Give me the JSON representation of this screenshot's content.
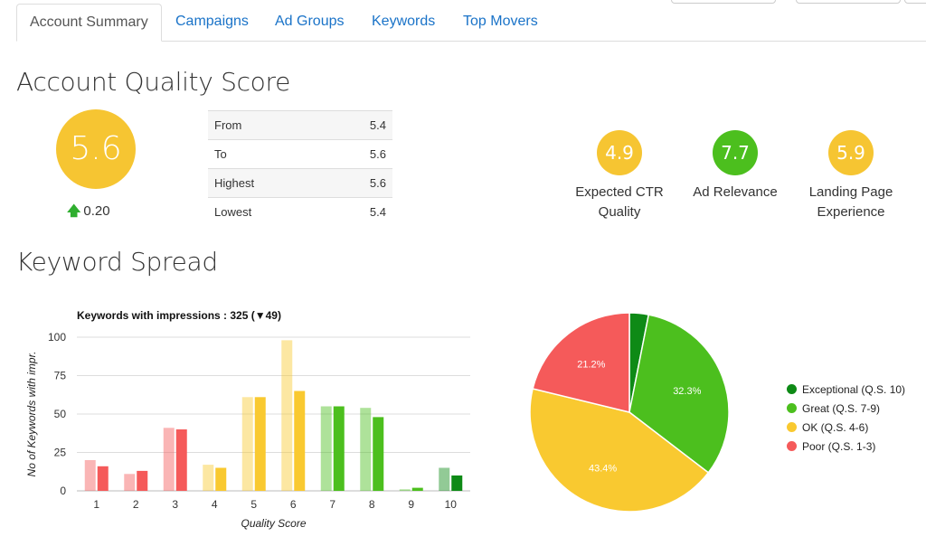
{
  "tabs": [
    {
      "label": "Account Summary",
      "active": true
    },
    {
      "label": "Campaigns",
      "active": false
    },
    {
      "label": "Ad Groups",
      "active": false
    },
    {
      "label": "Keywords",
      "active": false
    },
    {
      "label": "Top Movers",
      "active": false
    }
  ],
  "quality": {
    "heading": "Account Quality Score",
    "score": "5.6",
    "delta": "0.20",
    "table": [
      {
        "label": "From",
        "value": "5.4"
      },
      {
        "label": "To",
        "value": "5.6"
      },
      {
        "label": "Highest",
        "value": "5.6"
      },
      {
        "label": "Lowest",
        "value": "5.4"
      }
    ],
    "components": [
      {
        "value": "4.9",
        "line1": "Expected CTR",
        "line2": "Quality",
        "color": "#f6c532"
      },
      {
        "value": "7.7",
        "line1": "Ad Relevance",
        "line2": "",
        "color": "#4cbf1e"
      },
      {
        "value": "5.9",
        "line1": "Landing Page",
        "line2": "Experience",
        "color": "#f6c532"
      }
    ]
  },
  "spread": {
    "heading": "Keyword Spread"
  },
  "colors": {
    "exceptional": "#0e8a16",
    "great": "#4cbf1e",
    "ok": "#f9c930",
    "poor": "#f55a5a"
  },
  "chart_data": [
    {
      "type": "bar",
      "title": "Keywords with impressions : 325 (▼49)",
      "xlabel": "Quality Score",
      "ylabel": "No of Keywords with impr.",
      "ylim": [
        0,
        100
      ],
      "yticks": [
        0,
        25,
        50,
        75,
        100
      ],
      "categories": [
        "1",
        "2",
        "3",
        "4",
        "5",
        "6",
        "7",
        "8",
        "9",
        "10"
      ],
      "series": [
        {
          "values": [
            20,
            11,
            41,
            17,
            61,
            98,
            55,
            54,
            1,
            15
          ]
        },
        {
          "values": [
            16,
            13,
            40,
            15,
            61,
            65,
            55,
            48,
            2,
            10
          ]
        }
      ],
      "bar_colors": [
        "poor",
        "poor",
        "poor",
        "ok",
        "ok",
        "ok",
        "great",
        "great",
        "great",
        "exceptional"
      ],
      "grid": true
    },
    {
      "type": "pie",
      "labels": [
        "Exceptional (Q.S. 10)",
        "Great (Q.S. 7-9)",
        "OK (Q.S. 4-6)",
        "Poor (Q.S. 1-3)"
      ],
      "values": [
        3.1,
        32.3,
        43.4,
        21.2
      ],
      "value_labels": [
        "",
        "32.3%",
        "43.4%",
        "21.2%"
      ],
      "colors": [
        "exceptional",
        "great",
        "ok",
        "poor"
      ],
      "legend": "right"
    }
  ]
}
